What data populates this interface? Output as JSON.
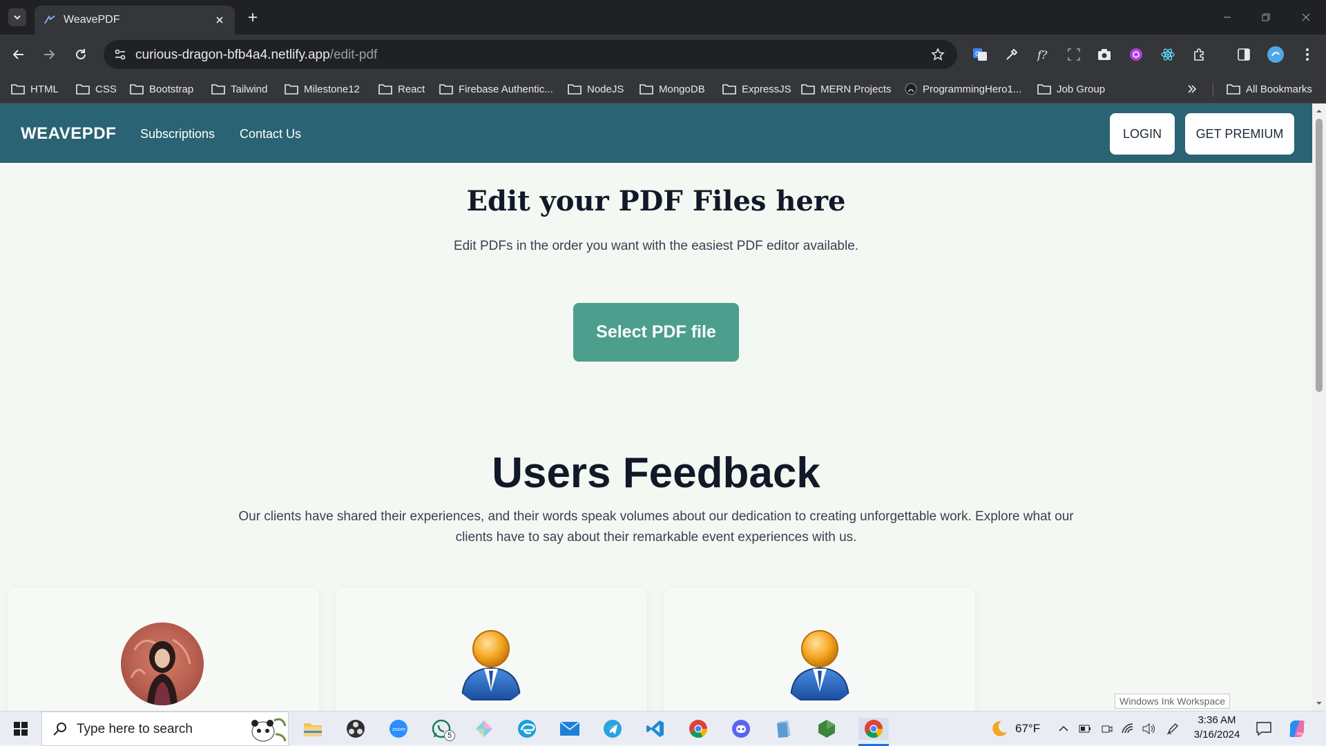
{
  "browser": {
    "tab_title": "WeavePDF",
    "url_domain": "curious-dragon-bfb4a4.netlify.app",
    "url_path": "/edit-pdf",
    "bookmarks": [
      {
        "label": "HTML",
        "icon": "folder-icon"
      },
      {
        "label": "CSS",
        "icon": "folder-icon"
      },
      {
        "label": "Bootstrap",
        "icon": "folder-icon"
      },
      {
        "label": "Tailwind",
        "icon": "folder-icon"
      },
      {
        "label": "Milestone12",
        "icon": "folder-icon"
      },
      {
        "label": "React",
        "icon": "folder-icon"
      },
      {
        "label": "Firebase Authentic...",
        "icon": "folder-icon"
      },
      {
        "label": "NodeJS",
        "icon": "folder-icon"
      },
      {
        "label": "MongoDB",
        "icon": "folder-icon"
      },
      {
        "label": "ExpressJS",
        "icon": "folder-icon"
      },
      {
        "label": "MERN Projects",
        "icon": "folder-icon"
      },
      {
        "label": "ProgrammingHero1...",
        "icon": "github-icon"
      },
      {
        "label": "Job Group",
        "icon": "folder-icon"
      }
    ],
    "all_bookmarks": "All Bookmarks"
  },
  "site": {
    "brand": "WEAVEPDF",
    "nav": {
      "subscriptions": "Subscriptions",
      "contact": "Contact Us"
    },
    "login": "LOGIN",
    "premium": "GET PREMIUM",
    "hero": {
      "title": "Edit your PDF Files here",
      "subtitle": "Edit PDFs in the order you want with the easiest PDF editor available.",
      "button": "Select PDF file"
    },
    "feedback": {
      "title": "Users Feedback",
      "description": "Our clients have shared their experiences, and their words speak volumes about our dedication to creating unforgettable work. Explore what our clients have to say about their remarkable event experiences with us."
    },
    "cards": [
      {
        "avatar": "user-photo"
      },
      {
        "avatar": "default-user-icon"
      },
      {
        "avatar": "default-user-icon"
      }
    ]
  },
  "taskbar": {
    "search_placeholder": "Type here to search",
    "whatsapp_badge": "5",
    "weather": "67°F",
    "time": "3:36 AM",
    "date": "3/16/2024",
    "ink_tooltip": "Windows Ink Workspace"
  },
  "colors": {
    "navbar": "#2a6373",
    "accent_button": "#4c9f8d",
    "page_bg": "#f3f8f2"
  }
}
